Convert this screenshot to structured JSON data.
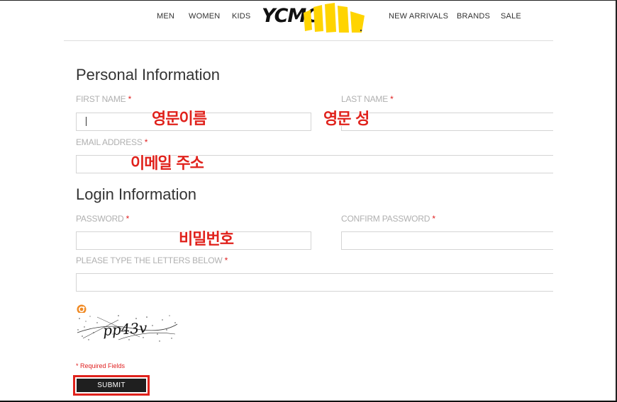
{
  "header": {
    "nav_left": [
      "MEN",
      "WOMEN",
      "KIDS"
    ],
    "logo_text": "YCMC",
    "nav_right": [
      "NEW ARRIVALS",
      "BRANDS",
      "SALE"
    ]
  },
  "personal": {
    "title": "Personal Information",
    "first_name_label": "FIRST NAME",
    "last_name_label": "LAST NAME",
    "email_label": "EMAIL ADDRESS",
    "required_mark": "*"
  },
  "login": {
    "title": "Login Information",
    "password_label": "PASSWORD",
    "confirm_password_label": "CONFIRM PASSWORD",
    "captcha_label": "PLEASE TYPE THE LETTERS BELOW",
    "captcha_text": "pp43v"
  },
  "annotations": {
    "first_name": "영문이름",
    "last_name": "영문 성",
    "email": "이메일 주소",
    "password": "비밀번호"
  },
  "footer": {
    "required_note": "* Required Fields",
    "submit_label": "SUBMIT"
  },
  "colors": {
    "accent_yellow": "#FFD400",
    "required_red": "#e02020",
    "annotation_red": "#e0221c"
  }
}
